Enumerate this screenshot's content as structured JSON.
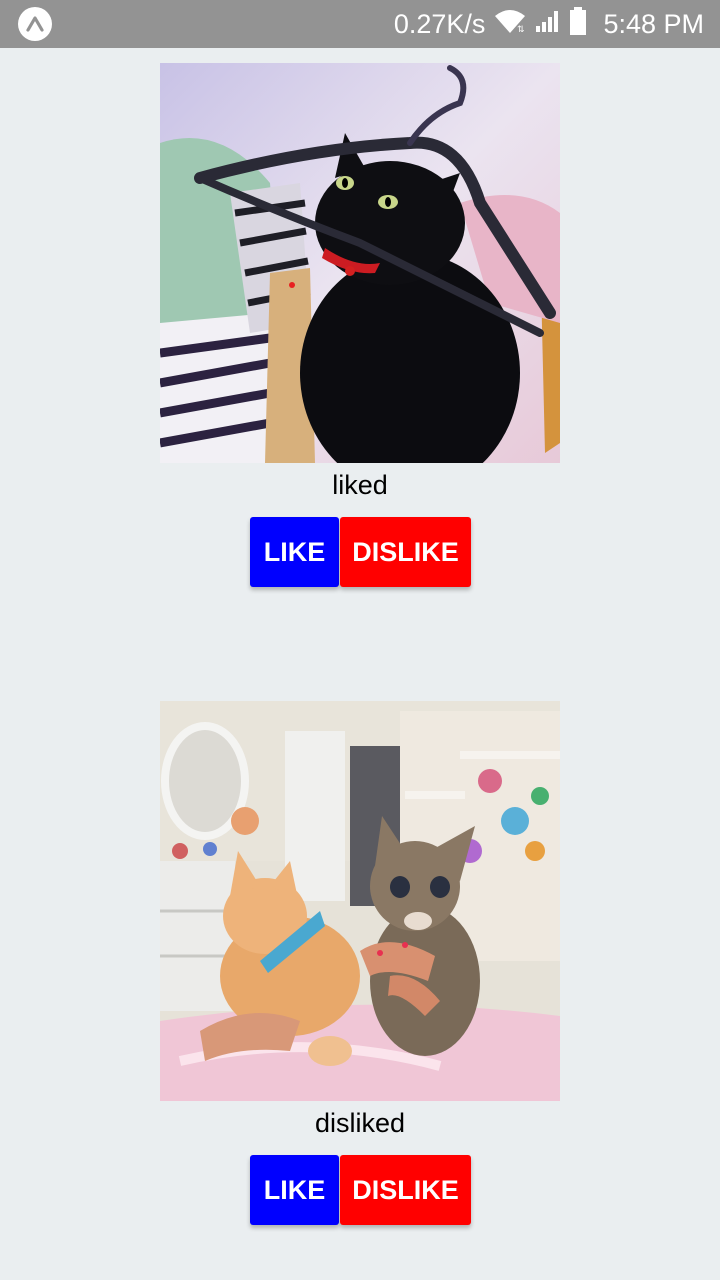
{
  "status_bar": {
    "net_speed": "0.27K/s",
    "time": "5:48 PM",
    "icons": [
      "expo-app-icon",
      "wifi-icon",
      "signal-icon",
      "battery-icon"
    ],
    "background_color": "#939393"
  },
  "cards": [
    {
      "image_alt": "black-cat-with-hanger",
      "status": "liked",
      "like_label": "LIKE",
      "dislike_label": "DISLIKE"
    },
    {
      "image_alt": "two-kittens-held",
      "status": "disliked",
      "like_label": "LIKE",
      "dislike_label": "DISLIKE"
    }
  ],
  "colors": {
    "like": "#0000ff",
    "dislike": "#ff0000",
    "background": "#eaeef0"
  }
}
